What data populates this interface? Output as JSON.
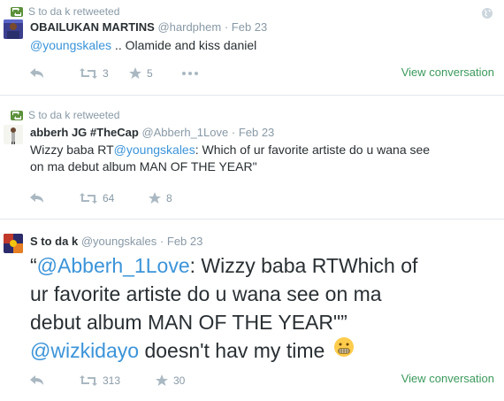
{
  "tweets": [
    {
      "retweet_line": "S to da k retweeted",
      "name": "OBAILUKAN MARTINS",
      "handle": "@hardphem",
      "date": "Feb 23",
      "mention": "@youngskales",
      "text_after": " .. Olamide and kiss daniel",
      "retweets": "3",
      "favorites": "5",
      "view_conversation": "View conversation"
    },
    {
      "retweet_line": "S to da k retweeted",
      "name": "abberh JG #TheCap",
      "handle": "@Abberh_1Love",
      "date": "Feb 23",
      "text_before": "Wizzy baba RT",
      "mention": "@youngskales",
      "text_after": ": Which of ur favorite artiste do u wana see",
      "line2": "on ma debut album MAN OF THE YEAR\"",
      "retweets": "64",
      "favorites": "8"
    },
    {
      "name": "S to da k",
      "handle": "@youngskales",
      "date": "Feb 23",
      "quote_open": "“",
      "mention1": "@Abberh_1Love",
      "line1_rest": ": Wizzy baba RTWhich of",
      "line2": "ur favorite artiste do u wana see on ma",
      "line3": "debut album MAN OF THE YEAR\"”",
      "mention2": "@wizkidayo",
      "line4_rest": " doesn't hav my time",
      "retweets": "313",
      "favorites": "30",
      "view_conversation": "View conversation"
    }
  ],
  "separator": "·",
  "icons": [
    "retweet-icon",
    "reply-icon",
    "favorite-icon",
    "more-icon",
    "globe-icon",
    "grimace-emoji-icon"
  ],
  "colors": {
    "link": "#3b94d9",
    "retweet_green": "#5c913b",
    "meta_gray": "#8899a6",
    "view_conv": "#3b9a5c"
  }
}
